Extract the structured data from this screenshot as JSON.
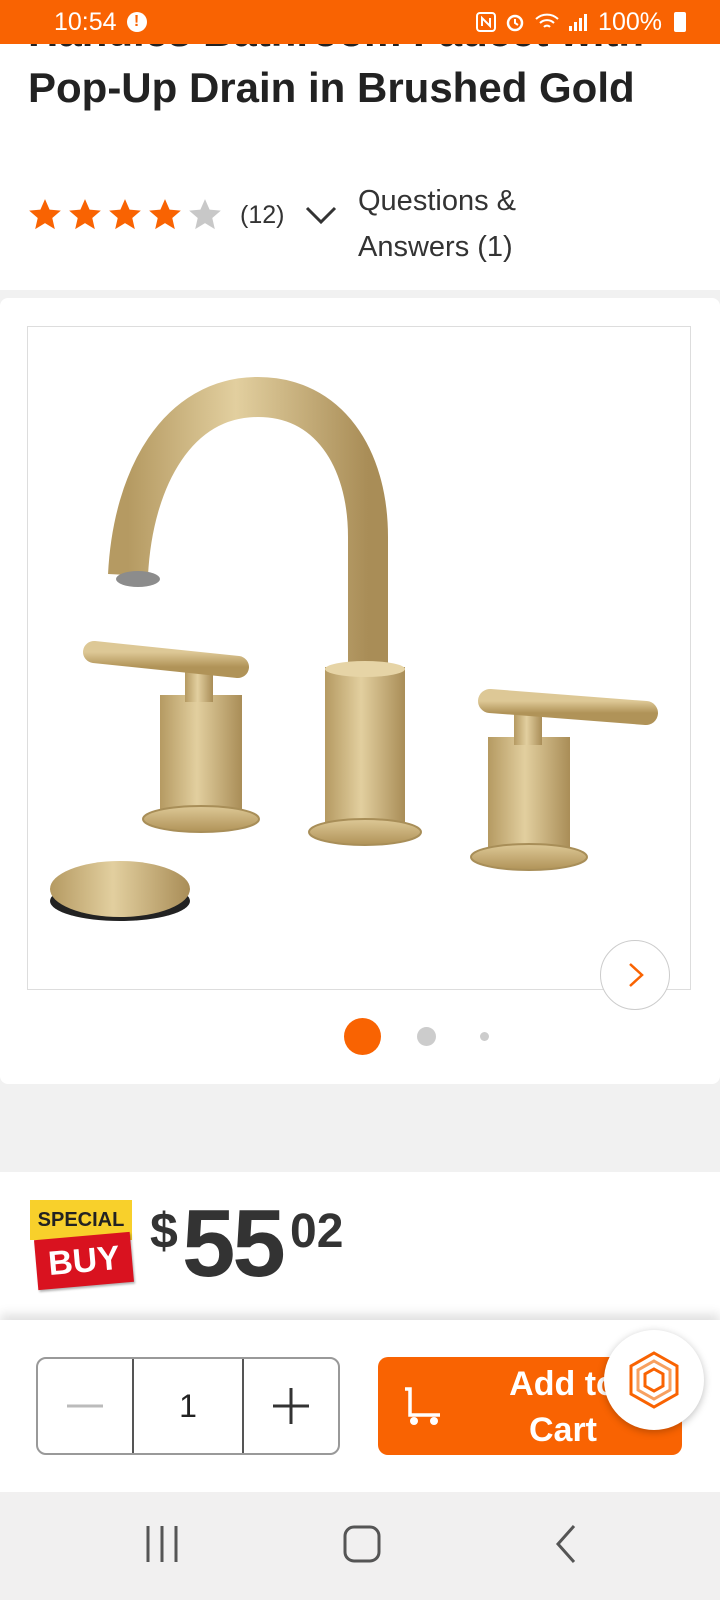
{
  "status_bar": {
    "time": "10:54",
    "battery": "100%",
    "icons": [
      "alert-icon",
      "nfc-icon",
      "alarm-icon",
      "wifi-icon",
      "signal-icon",
      "battery-icon"
    ]
  },
  "product": {
    "title": "Handles Bathroom Faucet with Pop-Up Drain in Brushed Gold",
    "rating": 4,
    "rating_max": 5,
    "review_count": "(12)",
    "qa_label": "Questions & Answers (1)"
  },
  "gallery": {
    "total_images": 3,
    "active_index": 0
  },
  "pricing": {
    "badge_top": "SPECIAL",
    "badge_bottom": "BUY",
    "currency": "$",
    "whole": "55",
    "cents": "02"
  },
  "cart": {
    "quantity": "1",
    "add_label": "Add to Cart"
  },
  "colors": {
    "brand": "#f96302",
    "star_filled": "#f96302",
    "star_empty": "#c8c8c8",
    "special_yellow": "#f8d02b",
    "special_red": "#d9121f"
  }
}
